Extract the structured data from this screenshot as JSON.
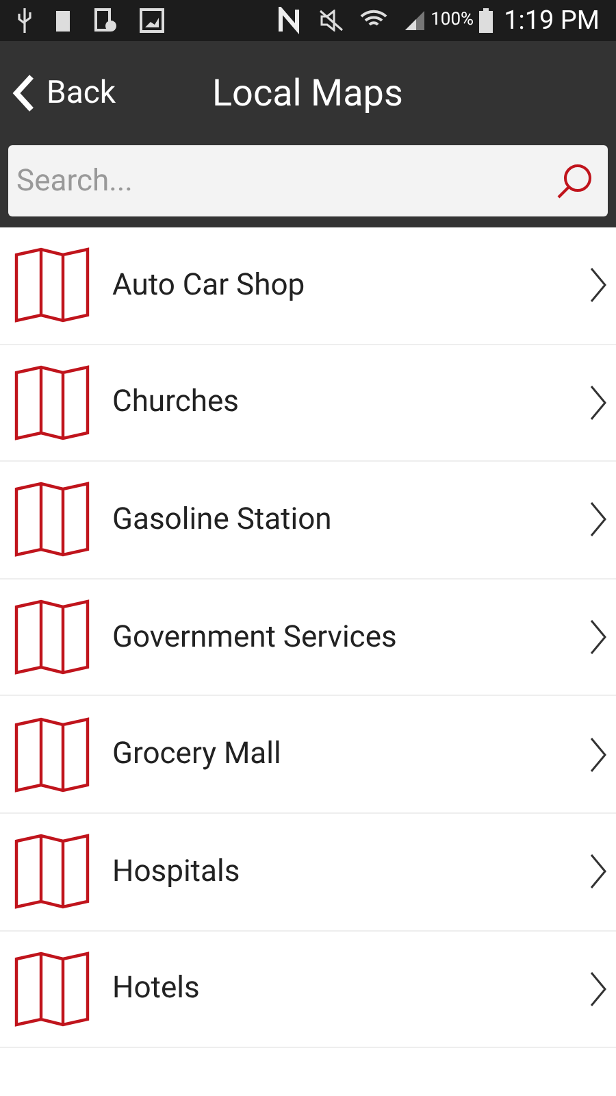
{
  "status_bar": {
    "battery": "100%",
    "time": "1:19 PM"
  },
  "header": {
    "back": "Back",
    "title": "Local Maps"
  },
  "search": {
    "placeholder": "Search..."
  },
  "items": [
    {
      "label": "Auto Car Shop"
    },
    {
      "label": "Churches"
    },
    {
      "label": "Gasoline Station"
    },
    {
      "label": "Government Services"
    },
    {
      "label": "Grocery Mall"
    },
    {
      "label": "Hospitals"
    },
    {
      "label": "Hotels"
    }
  ]
}
